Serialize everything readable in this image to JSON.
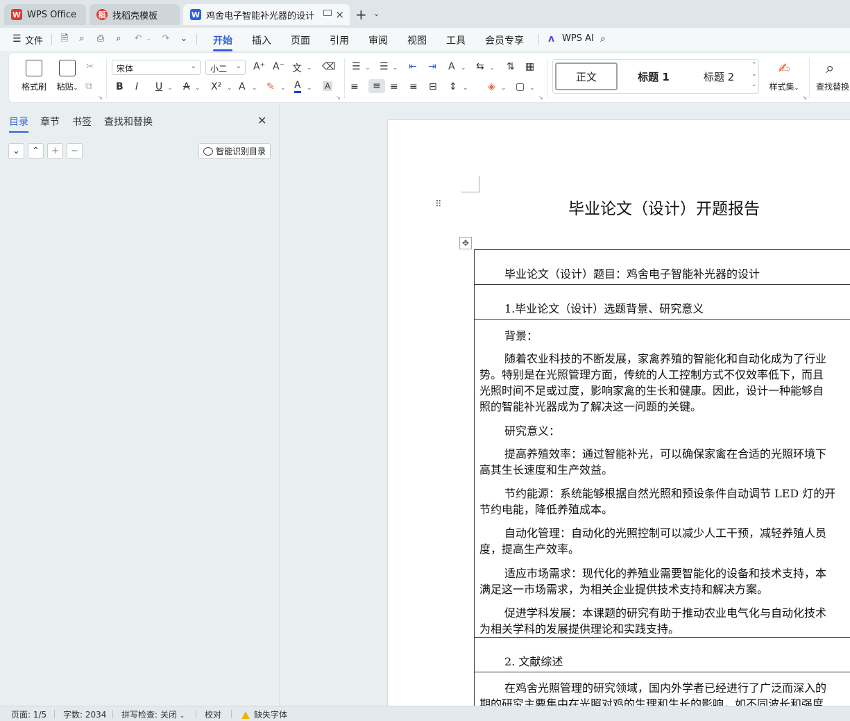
{
  "tabs": [
    {
      "label": "WPS Office",
      "icon": "wps-logo-icon"
    },
    {
      "label": "找稻壳模板",
      "icon": "docer-icon"
    },
    {
      "label": "鸡舍电子智能补光器的设计 开",
      "icon": "writer-icon"
    }
  ],
  "menu": {
    "file": "文件",
    "items": [
      "开始",
      "插入",
      "页面",
      "引用",
      "审阅",
      "视图",
      "工具",
      "会员专享"
    ],
    "active": "开始",
    "ai": "WPS AI"
  },
  "ribbon": {
    "format_painter": "格式刷",
    "paste": "粘贴",
    "font_name": "宋体",
    "font_size": "小二",
    "styles": [
      "正文",
      "标题 1",
      "标题 2"
    ],
    "style_set": "样式集",
    "find_replace": "查找替换"
  },
  "nav": {
    "tabs": [
      "目录",
      "章节",
      "书签",
      "查找和替换"
    ],
    "smart_toc": "智能识别目录"
  },
  "document": {
    "title": "毕业论文（设计）开题报告",
    "rows": [
      "毕业论文（设计）题目：鸡舍电子智能补光器的设计",
      "1.毕业论文（设计）选题背景、研究意义"
    ],
    "background_label": "背景：",
    "bg_lines": [
      "随着农业科技的不断发展，家禽养殖的智能化和自动化成为了行业",
      "势。特别是在光照管理方面，传统的人工控制方式不仅效率低下，而且",
      "光照时间不足或过度，影响家禽的生长和健康。因此，设计一种能够自",
      "照的智能补光器成为了解决这一问题的关键。"
    ],
    "significance_label": "研究意义：",
    "p1": [
      "提高养殖效率：通过智能补光，可以确保家禽在合适的光照环境下",
      "高其生长速度和生产效益。"
    ],
    "p2": [
      "节约能源：系统能够根据自然光照和预设条件自动调节 LED 灯的开",
      "节约电能，降低养殖成本。"
    ],
    "p3": [
      "自动化管理：自动化的光照控制可以减少人工干预，减轻养殖人员",
      "度，提高生产效率。"
    ],
    "p4": [
      "适应市场需求：现代化的养殖业需要智能化的设备和技术支持，本",
      "满足这一市场需求，为相关企业提供技术支持和解决方案。"
    ],
    "p5": [
      "促进学科发展：本课题的研究有助于推动农业电气化与自动化技术",
      "为相关学科的发展提供理论和实践支持。"
    ],
    "section2": "2. 文献综述",
    "lit": [
      "在鸡舍光照管理的研究领域，国内外学者已经进行了广泛而深入的",
      "期的研究主要集中在光照对鸡的生理和生长的影响，如不同波长和强度"
    ]
  },
  "status": {
    "page": "页面: 1/5",
    "words": "字数: 2034",
    "spell": "拼写检查: 关闭",
    "proof": "校对",
    "missing_font": "缺失字体"
  },
  "colors": {
    "accent": "#2b62d9",
    "wps_red": "#e6352b",
    "writer_blue": "#2b62d9"
  }
}
